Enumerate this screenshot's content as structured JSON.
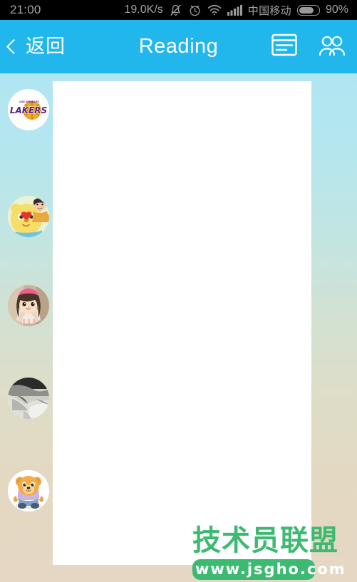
{
  "status_bar": {
    "time": "21:00",
    "network_speed": "19.0K/s",
    "icons": [
      "mute-bell-icon",
      "alarm-clock-icon",
      "wifi-icon",
      "signal-bars-icon"
    ],
    "carrier": "中国移动",
    "battery_percent": "90%",
    "battery_level": 90,
    "background_color": "#000000",
    "text_color": "#a3a3a3"
  },
  "title_bar": {
    "back_label": "返回",
    "title": "Reading",
    "background_color": "#22b7ec",
    "text_color": "#ffffff",
    "actions": [
      {
        "name": "article-list-icon",
        "label": ""
      },
      {
        "name": "members-group-icon",
        "label": ""
      }
    ]
  },
  "content": {
    "background_gradient_top": "#b0e6f2",
    "background_gradient_bottom": "#e5d7c4",
    "panel_background": "#ffffff",
    "panel_text": ""
  },
  "avatar_rail": {
    "items": [
      {
        "name": "avatar-lakers",
        "alt": "LA Lakers logo"
      },
      {
        "name": "avatar-yellow-bear-heart",
        "alt": "Yellow cartoon bear with red heart"
      },
      {
        "name": "avatar-girl-pink-headband",
        "alt": "Girl with pink headband"
      },
      {
        "name": "avatar-grayscale-photo",
        "alt": "Black and white photo"
      },
      {
        "name": "avatar-orange-bear",
        "alt": "Orange cartoon bear sitting"
      }
    ]
  },
  "watermark": {
    "title": "技术员联盟",
    "url": "www.jsgho.com",
    "color": "#3cba72"
  }
}
